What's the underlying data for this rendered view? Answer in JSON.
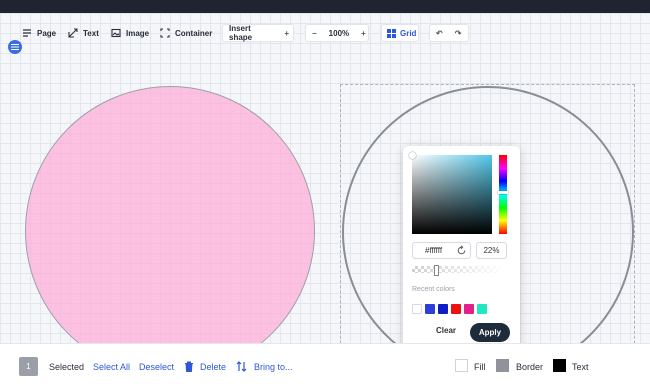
{
  "toolbar": {
    "page": "Page",
    "text": "Text",
    "image": "Image",
    "container": "Container",
    "insert_shape": "Insert shape",
    "zoom": "100%",
    "grid": "Grid"
  },
  "color_picker": {
    "hex_value": "#ffffff",
    "opacity": "22%",
    "recent_label": "Recent colors",
    "recent_colors": [
      "#ffffff",
      "#2b3fd9",
      "#0d1fc4",
      "#ee1111",
      "#e21f8b",
      "#21e6c1"
    ],
    "clear_label": "Clear",
    "apply_label": "Apply"
  },
  "bottom": {
    "count": "1",
    "selected": "Selected",
    "select_all": "Select All",
    "deselect": "Deselect",
    "delete": "Delete",
    "bring_to": "Bring to...",
    "fill": "Fill",
    "border": "Border",
    "text": "Text"
  },
  "colors": {
    "accent": "#2d58d6",
    "shape_fill": "#ffb6da",
    "apply_bg": "#1d2b3a"
  }
}
